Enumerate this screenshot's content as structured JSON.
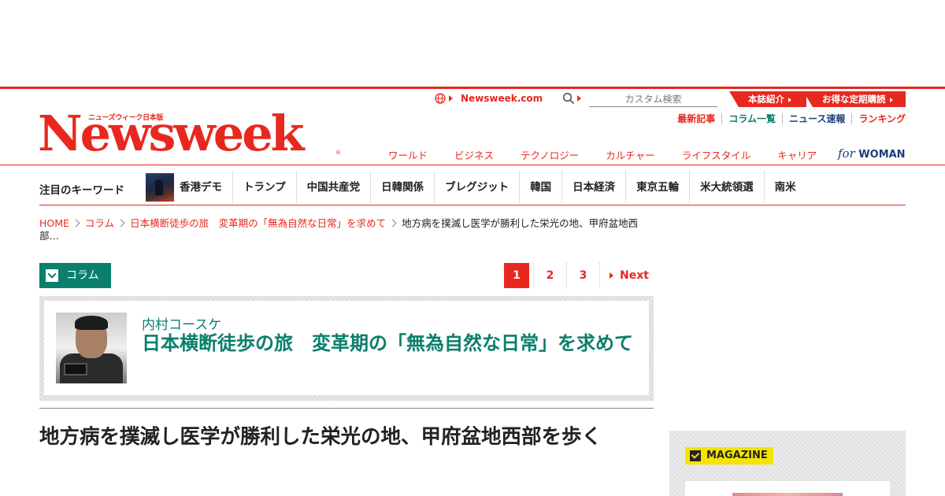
{
  "header": {
    "site_link": "Newsweek.com",
    "search_placeholder": "カスタム検索",
    "tabs": [
      "本誌紹介",
      "お得な定期購読"
    ],
    "sub_links": [
      {
        "label": "最新記事",
        "color": "#e8281f"
      },
      {
        "label": "コラム一覧",
        "color": "#0a7f6b"
      },
      {
        "label": "ニュース速報",
        "color": "#1b3d77"
      },
      {
        "label": "ランキング",
        "color": "#e8281f"
      }
    ],
    "logo_sub": "ニューズウィーク日本版",
    "logo": "Newsweek",
    "logo_reg": "®",
    "nav": [
      "ワールド",
      "ビジネス",
      "テクノロジー",
      "カルチャー",
      "ライフスタイル",
      "キャリア"
    ],
    "for_woman_prefix": "for",
    "for_woman": "WOMAN"
  },
  "keywords": {
    "label": "注目のキーワード",
    "items": [
      "香港デモ",
      "トランプ",
      "中国共産党",
      "日韓関係",
      "ブレグジット",
      "韓国",
      "日本経済",
      "東京五輪",
      "米大統領選",
      "南米"
    ]
  },
  "breadcrumb": {
    "items": [
      "HOME",
      "コラム",
      "日本横断徒歩の旅　変革期の「無為自然な日常」を求めて"
    ],
    "current": "地方病を撲滅し医学が勝利した栄光の地、甲府盆地西部…"
  },
  "column_badge": "コラム",
  "pager": {
    "pages": [
      "1",
      "2",
      "3"
    ],
    "active": "1",
    "next": "Next"
  },
  "column": {
    "author": "内村コースケ",
    "title": "日本横断徒歩の旅　変革期の「無為自然な日常」を求めて"
  },
  "article": {
    "title": "地方病を撲滅し医学が勝利した栄光の地、甲府盆地西部を歩く"
  },
  "sidebar": {
    "magazine_label": "MAGAZINE"
  },
  "colors": {
    "brand_red": "#e8281f",
    "teal": "#0a7f6b",
    "navy": "#1b3d77",
    "magazine_yellow": "#f5e400"
  }
}
